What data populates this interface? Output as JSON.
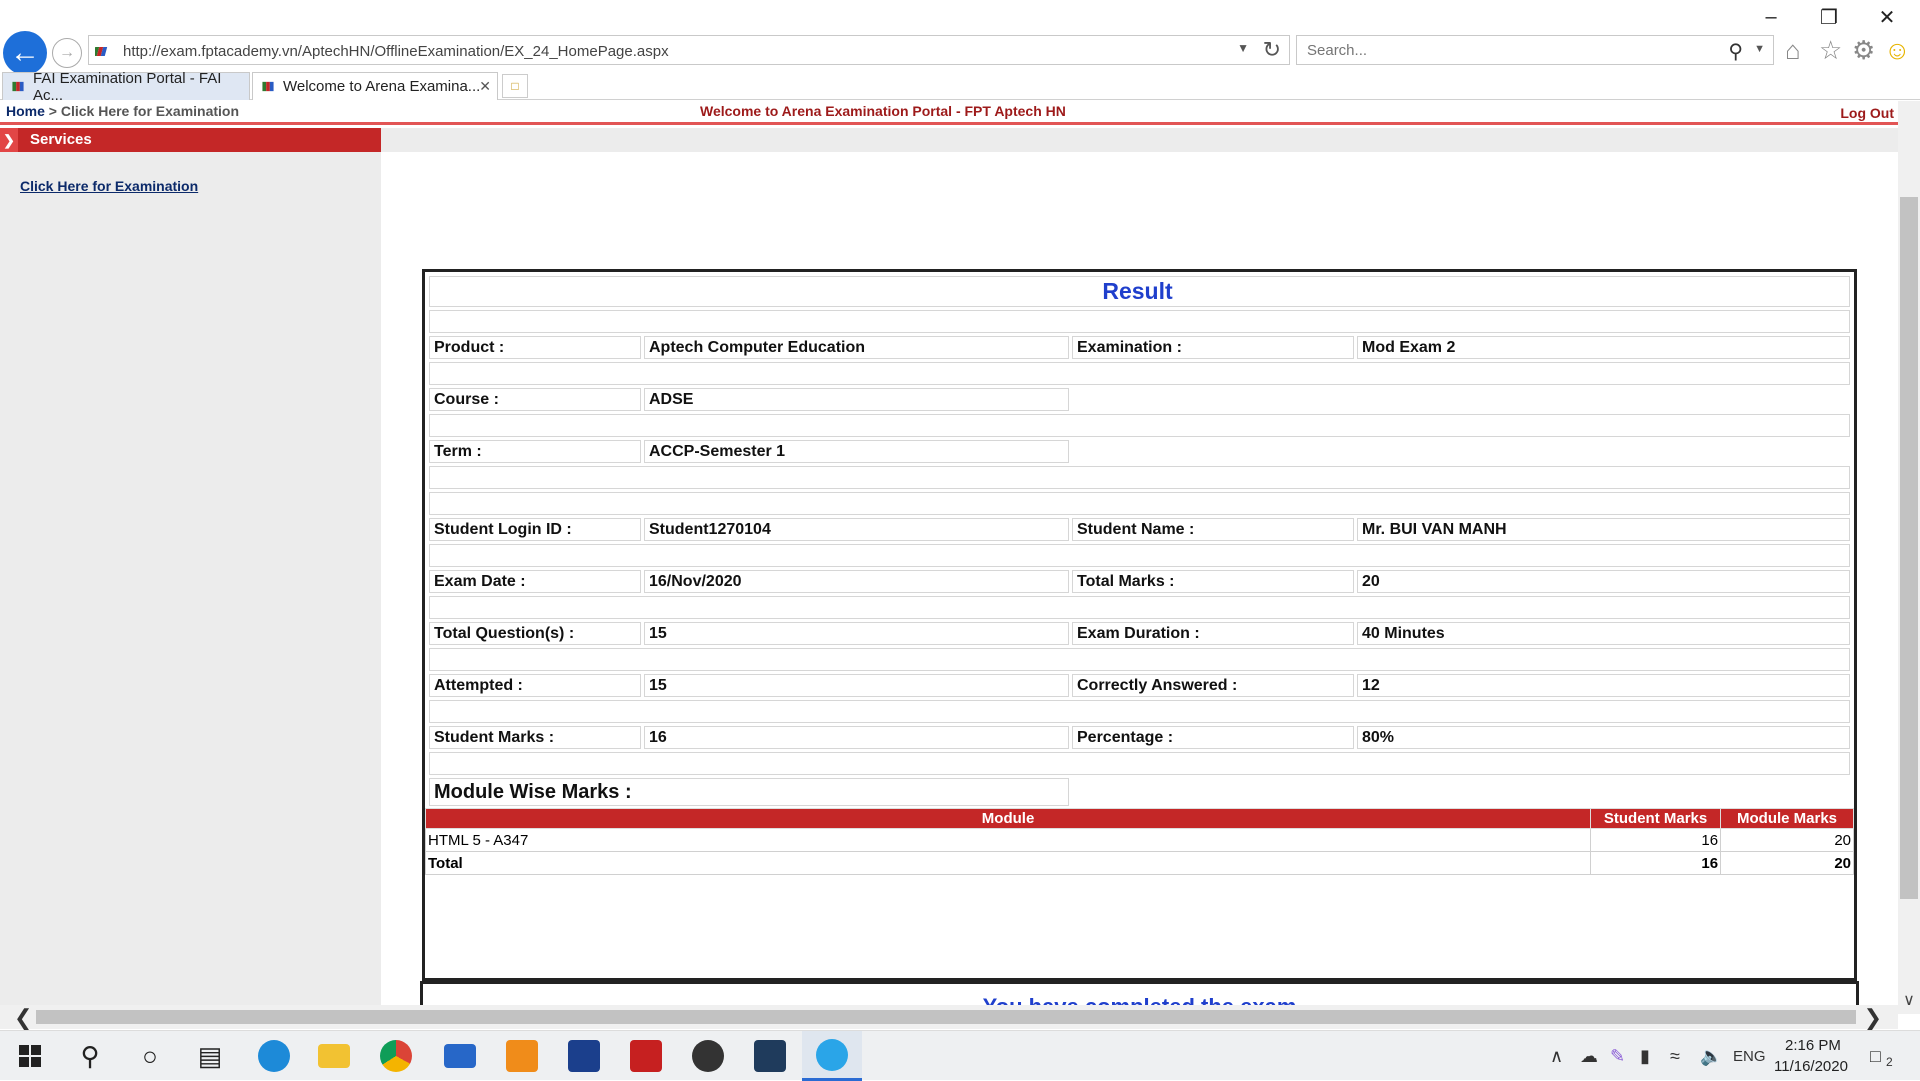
{
  "browser": {
    "url": "http://exam.fptacademy.vn/AptechHN/OfflineExamination/EX_24_HomePage.aspx",
    "search_placeholder": "Search...",
    "tabs": [
      {
        "label": "FAI Examination Portal - FAI Ac..."
      },
      {
        "label": "Welcome to Arena Examina..."
      }
    ]
  },
  "header": {
    "breadcrumb_home": "Home",
    "breadcrumb_current": "> Click Here for Examination",
    "welcome": "Welcome to Arena Examination Portal - FPT Aptech HN",
    "logout": "Log Out"
  },
  "sidebar": {
    "services": "Services",
    "link": "Click Here for Examination"
  },
  "result": {
    "title": "Result",
    "product_label": "Product :",
    "product": "Aptech Computer Education",
    "examination_label": "Examination :",
    "examination": "Mod Exam 2",
    "course_label": "Course :",
    "course": "ADSE",
    "term_label": "Term :",
    "term": "ACCP-Semester 1",
    "login_label": "Student Login ID :",
    "login": "Student1270104",
    "name_label": "Student Name :",
    "name": "Mr. BUI VAN MANH",
    "date_label": "Exam Date :",
    "date": "16/Nov/2020",
    "total_marks_label": "Total Marks :",
    "total_marks": "20",
    "questions_label": "Total Question(s) :",
    "questions": "15",
    "duration_label": "Exam Duration :",
    "duration": "40 Minutes",
    "attempted_label": "Attempted :",
    "attempted": "15",
    "correct_label": "Correctly Answered :",
    "correct": "12",
    "student_marks_label": "Student Marks :",
    "student_marks": "16",
    "percentage_label": "Percentage :",
    "percentage": "80%",
    "module_heading": "Module Wise Marks :",
    "table": {
      "headers": [
        "Module",
        "Student Marks",
        "Module Marks"
      ],
      "rows": [
        {
          "module": "HTML 5 - A347",
          "student": "16",
          "max": "20"
        }
      ],
      "total": {
        "label": "Total",
        "student": "16",
        "max": "20"
      }
    },
    "completed": "You have completed the exam"
  },
  "taskbar": {
    "language": "ENG",
    "time": "2:16 PM",
    "date": "11/16/2020",
    "notifications": "2"
  }
}
